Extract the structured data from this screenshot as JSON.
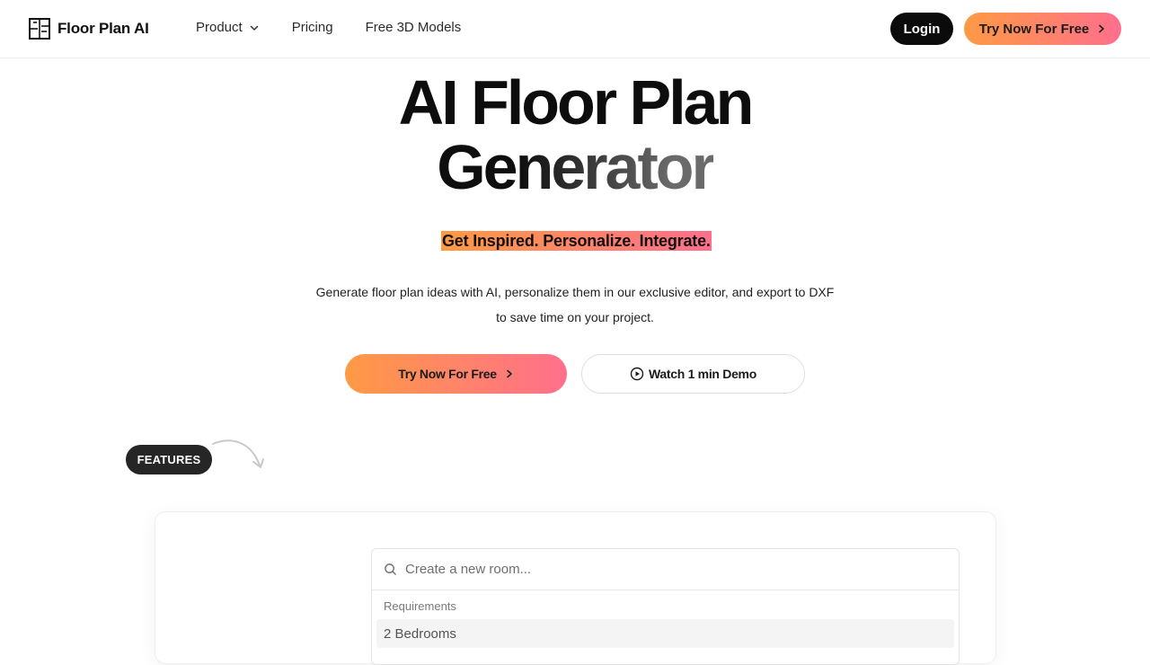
{
  "nav": {
    "brand": "Floor Plan AI",
    "menu": [
      {
        "label": "Product",
        "has_dropdown": true,
        "icon": "chevron-down-icon"
      },
      {
        "label": "Pricing"
      },
      {
        "label": "Free 3D Models"
      }
    ],
    "login_label": "Login",
    "try_label": "Try Now For Free"
  },
  "hero": {
    "title_line1": "AI Floor Plan",
    "title_line2": "Generator",
    "tagline": "Get Inspired. Personalize. Integrate.",
    "description_line1": "Generate floor plan ideas with AI, personalize them in our exclusive editor, and export to DXF",
    "description_line2": "to save time on your project.",
    "primary_cta": "Try Now For Free",
    "secondary_cta": "Watch 1 min Demo"
  },
  "features": {
    "pill": "FEATURES"
  },
  "demo_panel": {
    "search_placeholder": "Create a new room...",
    "requirements_label": "Requirements",
    "requirements": [
      "2 Bedrooms"
    ]
  },
  "colors": {
    "gradient_start": "#ff9a44",
    "gradient_end": "#ff6f8c",
    "dark": "#0b0b0b"
  }
}
